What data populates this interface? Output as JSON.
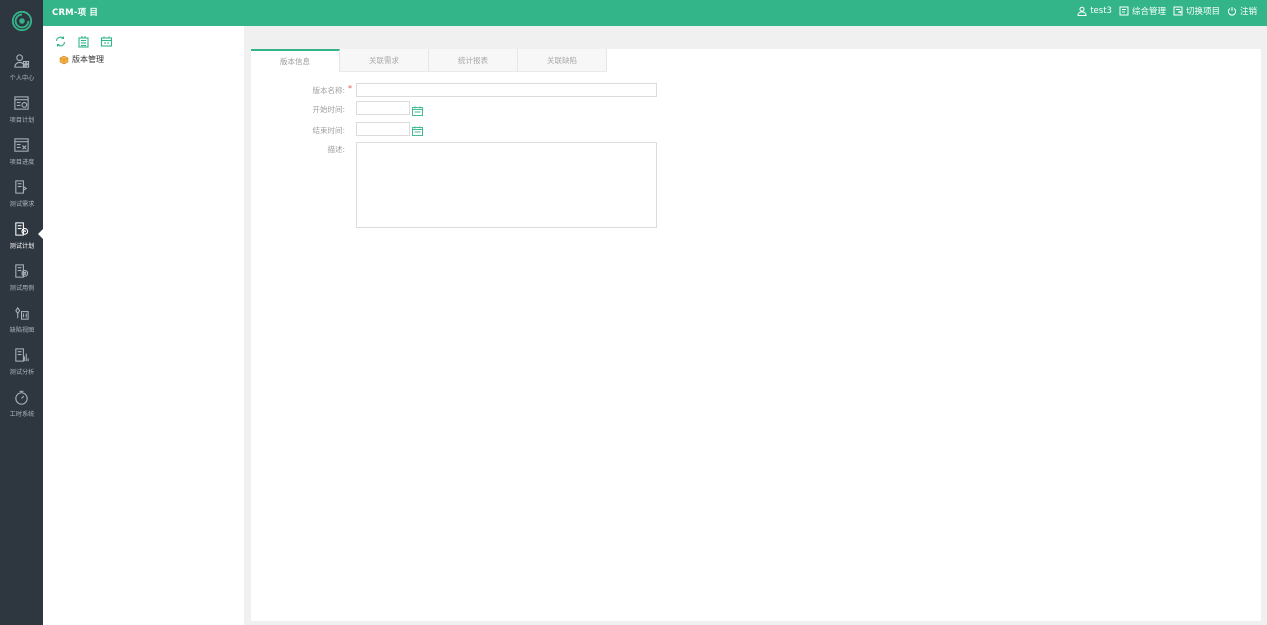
{
  "header": {
    "project_title": "CRM-项 目",
    "username": "test3",
    "links": [
      "综合管理",
      "切换项目",
      "注销"
    ]
  },
  "sidebar": {
    "items": [
      {
        "label": "个人中心",
        "icon": "user-center-icon"
      },
      {
        "label": "项目计划",
        "icon": "project-plan-icon"
      },
      {
        "label": "项目进度",
        "icon": "project-progress-icon"
      },
      {
        "label": "测试需求",
        "icon": "test-requirement-icon"
      },
      {
        "label": "测试计划",
        "icon": "test-plan-icon",
        "active": true
      },
      {
        "label": "测试用例",
        "icon": "test-case-icon"
      },
      {
        "label": "缺陷视图",
        "icon": "defect-view-icon"
      },
      {
        "label": "测试分析",
        "icon": "test-analysis-icon"
      },
      {
        "label": "工时系统",
        "icon": "timesheet-icon"
      }
    ]
  },
  "tree": {
    "tools": [
      "refresh-icon",
      "add-version-icon",
      "edit-version-icon"
    ],
    "root_label": "版本管理"
  },
  "tabs": [
    "版本信息",
    "关联需求",
    "统计报表",
    "关联缺陷"
  ],
  "form": {
    "name_label": "版本名称:",
    "required_mark": "*",
    "start_label": "开始时间:",
    "end_label": "结束时间:",
    "desc_label": "描述:",
    "name_value": "",
    "start_value": "",
    "end_value": "",
    "desc_value": ""
  },
  "colors": {
    "accent": "#33b589",
    "sidebar_bg": "#2e3640"
  }
}
